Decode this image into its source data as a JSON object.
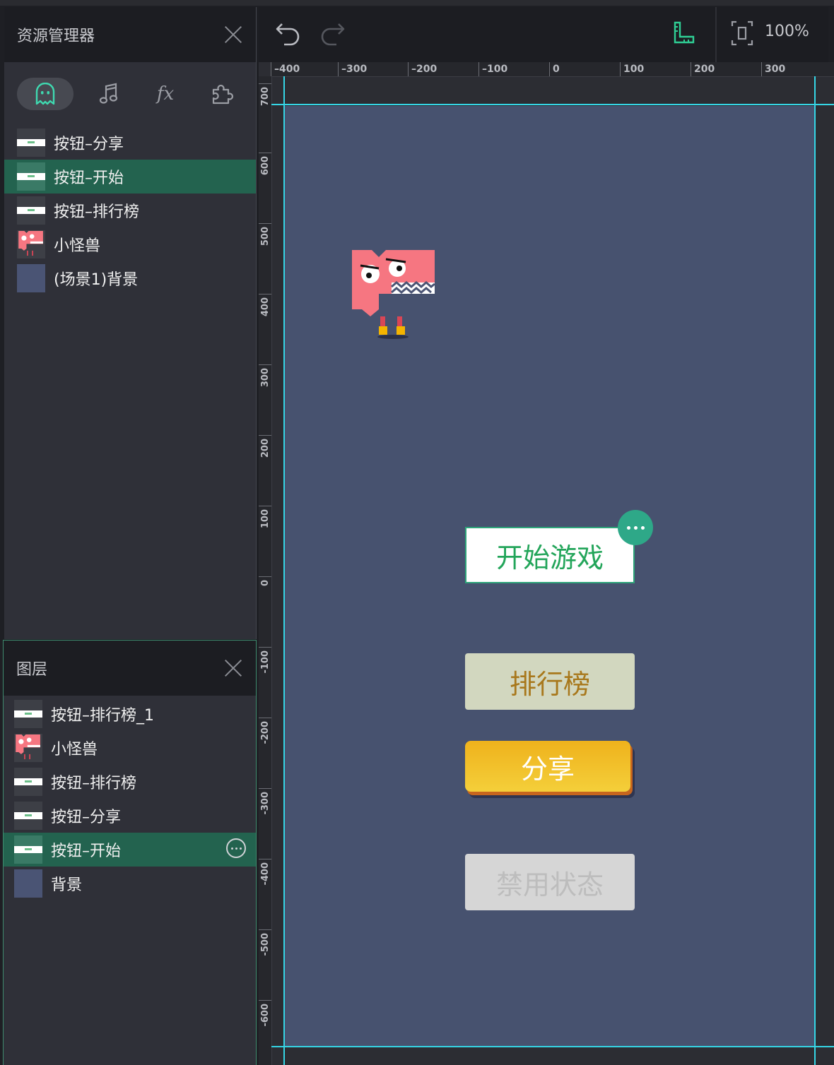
{
  "assets_panel": {
    "title": "资源管理器",
    "tabs": [
      {
        "icon": "ghost-icon",
        "active": true
      },
      {
        "icon": "music-note-icon"
      },
      {
        "icon": "fx-icon",
        "label": "fx"
      },
      {
        "icon": "puzzle-icon"
      }
    ],
    "items": [
      {
        "label": "按钮–分享",
        "thumb": "button"
      },
      {
        "label": "按钮–开始",
        "thumb": "button",
        "selected": true
      },
      {
        "label": "按钮–排行榜",
        "thumb": "button"
      },
      {
        "label": "小怪兽",
        "thumb": "monster"
      },
      {
        "label": "(场景1)背景",
        "thumb": "background"
      }
    ]
  },
  "layers_panel": {
    "title": "图层",
    "items": [
      {
        "label": "按钮–排行榜_1",
        "thumb": "button"
      },
      {
        "label": "小怪兽",
        "thumb": "monster"
      },
      {
        "label": "按钮–排行榜",
        "thumb": "button"
      },
      {
        "label": "按钮–分享",
        "thumb": "button"
      },
      {
        "label": "按钮–开始",
        "thumb": "button",
        "selected": true
      },
      {
        "label": "背景",
        "thumb": "background"
      }
    ]
  },
  "toolbar": {
    "undo_icon": "undo-icon",
    "redo_icon": "redo-icon",
    "ruler_icon": "ruler-icon",
    "fit_icon": "fit-screen-icon",
    "zoom": "100%"
  },
  "rulers": {
    "horizontal": [
      "–400",
      "–300",
      "–200",
      "–100",
      "0",
      "100",
      "200",
      "300"
    ],
    "vertical": [
      "700",
      "600",
      "500",
      "400",
      "300",
      "200",
      "100",
      "0",
      "-100",
      "-200",
      "-300",
      "-400",
      "-500",
      "-600"
    ]
  },
  "stage": {
    "buttons": {
      "start": "开始游戏",
      "rank": "排行榜",
      "share": "分享",
      "disabled": "禁用状态"
    }
  },
  "colors": {
    "accent": "#23634f",
    "canvas_bg": "#47526f",
    "guide": "#35d6e6",
    "start_text": "#23a55a",
    "share_bg": "#efb21c"
  }
}
